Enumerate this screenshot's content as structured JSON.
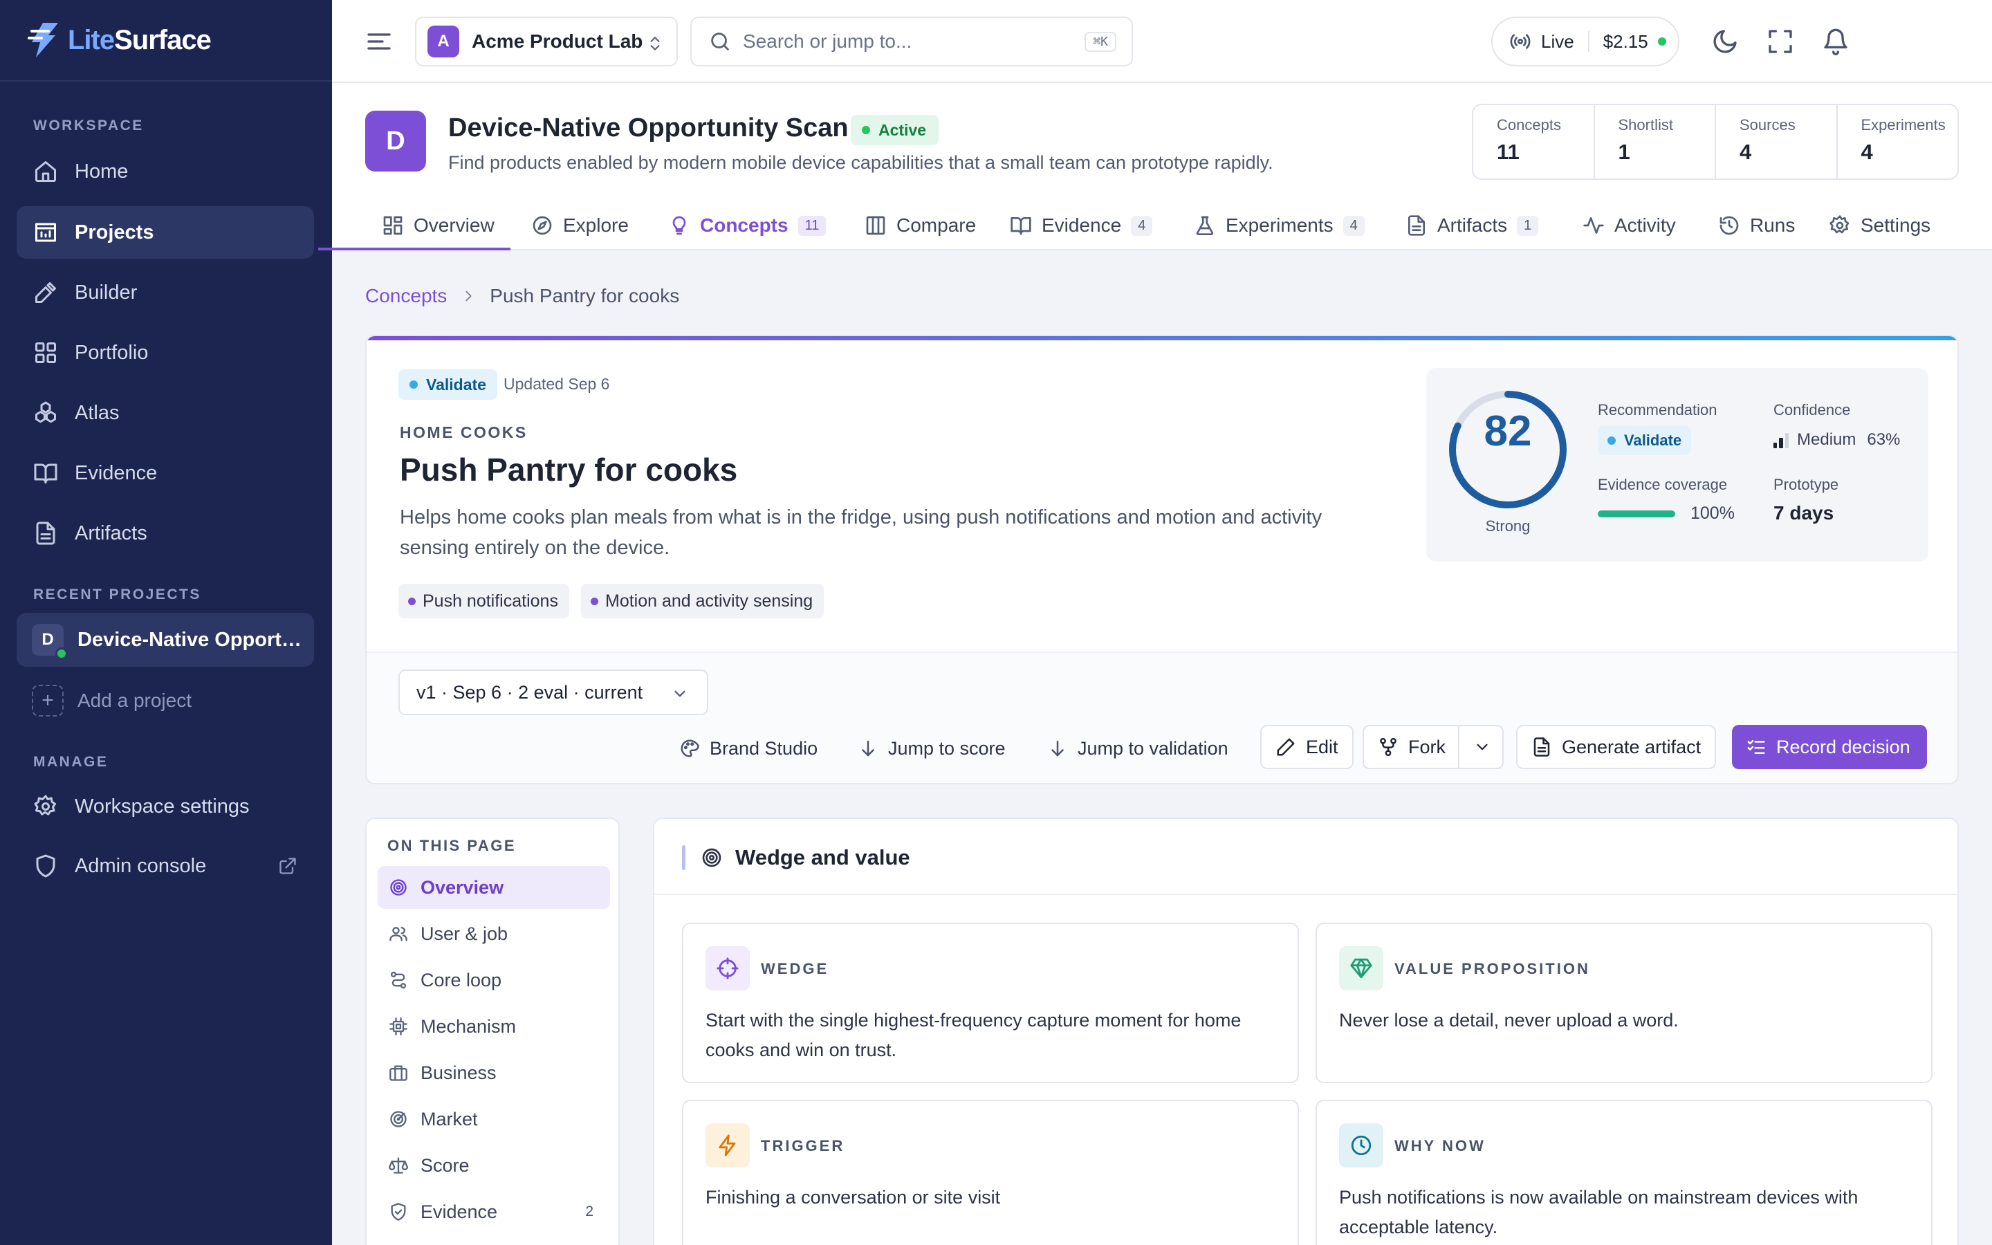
{
  "brand": {
    "part1": "Lite",
    "part2": "Surface"
  },
  "sidebar": {
    "workspace_label": "WORKSPACE",
    "items": [
      {
        "label": "Home",
        "icon": "home-icon"
      },
      {
        "label": "Projects",
        "icon": "projects-icon"
      },
      {
        "label": "Builder",
        "icon": "builder-icon"
      },
      {
        "label": "Portfolio",
        "icon": "portfolio-icon"
      },
      {
        "label": "Atlas",
        "icon": "atlas-icon"
      },
      {
        "label": "Evidence",
        "icon": "book-icon"
      },
      {
        "label": "Artifacts",
        "icon": "document-icon"
      }
    ],
    "recent_label": "RECENT PROJECTS",
    "recent": {
      "initial": "D",
      "name": "Device-Native Opport…"
    },
    "add_project": "Add a project",
    "manage_label": "MANAGE",
    "manage_items": [
      {
        "label": "Workspace settings",
        "icon": "gear-icon"
      },
      {
        "label": "Admin console",
        "icon": "shield-icon"
      }
    ]
  },
  "topbar": {
    "workspace": {
      "initial": "A",
      "name": "Acme Product Lab"
    },
    "search": {
      "placeholder": "Search or jump to...",
      "shortcut": "⌘K"
    },
    "live": {
      "label": "Live",
      "cost": "$2.15"
    }
  },
  "project": {
    "initial": "D",
    "title": "Device-Native Opportunity Scan",
    "status": "Active",
    "description": "Find products enabled by modern mobile device capabilities that a small team can prototype rapidly.",
    "stats": [
      {
        "label": "Concepts",
        "value": "11"
      },
      {
        "label": "Shortlist",
        "value": "1"
      },
      {
        "label": "Sources",
        "value": "4"
      },
      {
        "label": "Experiments",
        "value": "4"
      }
    ],
    "tabs": [
      {
        "label": "Overview",
        "count": ""
      },
      {
        "label": "Explore",
        "count": ""
      },
      {
        "label": "Concepts",
        "count": "11"
      },
      {
        "label": "Compare",
        "count": ""
      },
      {
        "label": "Evidence",
        "count": "4"
      },
      {
        "label": "Experiments",
        "count": "4"
      },
      {
        "label": "Artifacts",
        "count": "1"
      },
      {
        "label": "Activity",
        "count": ""
      },
      {
        "label": "Runs",
        "count": ""
      },
      {
        "label": "Settings",
        "count": ""
      }
    ]
  },
  "breadcrumb": {
    "parent": "Concepts",
    "current": "Push Pantry for cooks"
  },
  "concept": {
    "stage": "Validate",
    "updated": "Updated Sep 6",
    "segment": "HOME COOKS",
    "title": "Push Pantry for cooks",
    "description": "Helps home cooks plan meals from what is in the fridge, using push notifications and motion and activity sensing entirely on the device.",
    "capabilities": [
      "Push notifications",
      "Motion and activity sensing"
    ],
    "score": {
      "value": 82,
      "max": 100,
      "label": "Strong"
    },
    "recommendation_label": "Recommendation",
    "recommendation": "Validate",
    "confidence_label": "Confidence",
    "confidence": "Medium",
    "confidence_pct": "63%",
    "confidence_level": 2,
    "coverage_label": "Evidence coverage",
    "coverage": "100%",
    "coverage_fraction": 1.0,
    "prototype_label": "Prototype",
    "prototype": "7 days",
    "version": "v1 · Sep 6 · 2 eval · current",
    "actions": {
      "brand_studio": "Brand Studio",
      "jump_score": "Jump to score",
      "jump_validation": "Jump to validation",
      "edit": "Edit",
      "fork": "Fork",
      "generate": "Generate artifact",
      "record": "Record decision"
    }
  },
  "toc": {
    "title": "ON THIS PAGE",
    "items": [
      {
        "label": "Overview",
        "count": ""
      },
      {
        "label": "User & job",
        "count": ""
      },
      {
        "label": "Core loop",
        "count": ""
      },
      {
        "label": "Mechanism",
        "count": ""
      },
      {
        "label": "Business",
        "count": ""
      },
      {
        "label": "Market",
        "count": ""
      },
      {
        "label": "Score",
        "count": ""
      },
      {
        "label": "Evidence",
        "count": "2"
      }
    ]
  },
  "wedge_section": {
    "title": "Wedge and value",
    "boxes": [
      {
        "label": "WEDGE",
        "text": "Start with the single highest-frequency capture moment for home cooks and win on trust.",
        "icon": "crosshair-icon",
        "color": "#7c4fd6"
      },
      {
        "label": "VALUE PROPOSITION",
        "text": "Never lose a detail, never upload a word.",
        "icon": "gem-icon",
        "color": "#1f9d74"
      },
      {
        "label": "TRIGGER",
        "text": "Finishing a conversation or site visit",
        "icon": "lightning-icon",
        "color": "#d97706"
      },
      {
        "label": "WHY NOW",
        "text": "Push notifications is now available on mainstream devices with acceptable latency.",
        "icon": "clock-icon",
        "color": "#0e7490"
      }
    ]
  },
  "colors": {
    "accent": "#7c4fd6",
    "sidebar": "#1b2550",
    "success": "#22c55e",
    "score": "#1d5c9f"
  }
}
